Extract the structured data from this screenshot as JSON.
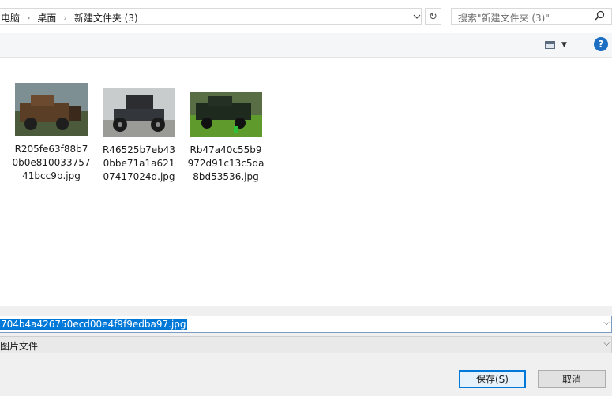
{
  "address": {
    "crumbs": [
      "电脑",
      "桌面",
      "新建文件夹 (3)"
    ],
    "separator": "›",
    "dropdown_icon": "chevron-down-icon",
    "refresh_glyph": "↻"
  },
  "search": {
    "placeholder": "搜索\"新建文件夹 (3)\"",
    "icon_glyph": "⚲"
  },
  "toolbar": {
    "view_caret": "▼",
    "help_label": "?"
  },
  "files": [
    {
      "name": "R205fe63f88b70b0e81003375741bcc9b.jpg",
      "name_lines": [
        "R205fe63f88b7",
        "0b0e810033757",
        "41bcc9b.jpg"
      ],
      "thumb_colors": {
        "sky": "#7d8f93",
        "ground": "#4a5a3a",
        "car": "#5a3e26"
      }
    },
    {
      "name": "R46525b7eb430bbe71a1a62107417024d.jpg",
      "name_lines": [
        "R46525b7eb43",
        "0bbe71a1a621",
        "07417024d.jpg"
      ],
      "thumb_colors": {
        "sky": "#c9cccd",
        "ground": "#9a9a96",
        "car": "#2b2d30"
      }
    },
    {
      "name": "Rb47a40c55b9972d91c13c5da8bd53536.jpg",
      "name_lines": [
        "Rb47a40c55b9",
        "972d91c13c5da",
        "8bd53536.jpg"
      ],
      "thumb_colors": {
        "sky": "#5a6e46",
        "ground": "#5f9a2c",
        "car": "#1e2a1e"
      }
    }
  ],
  "save_panel": {
    "filename": "704b4a426750ecd00e4f9f9edba97.jpg",
    "filetype": "图片文件",
    "dropdown_glyph": "⌵",
    "save_label": "保存(S)",
    "cancel_label": "取消"
  },
  "colors": {
    "accent": "#0078d7",
    "toolbar_bg": "#f5f6f7",
    "panel_bg": "#f0f0f0"
  }
}
